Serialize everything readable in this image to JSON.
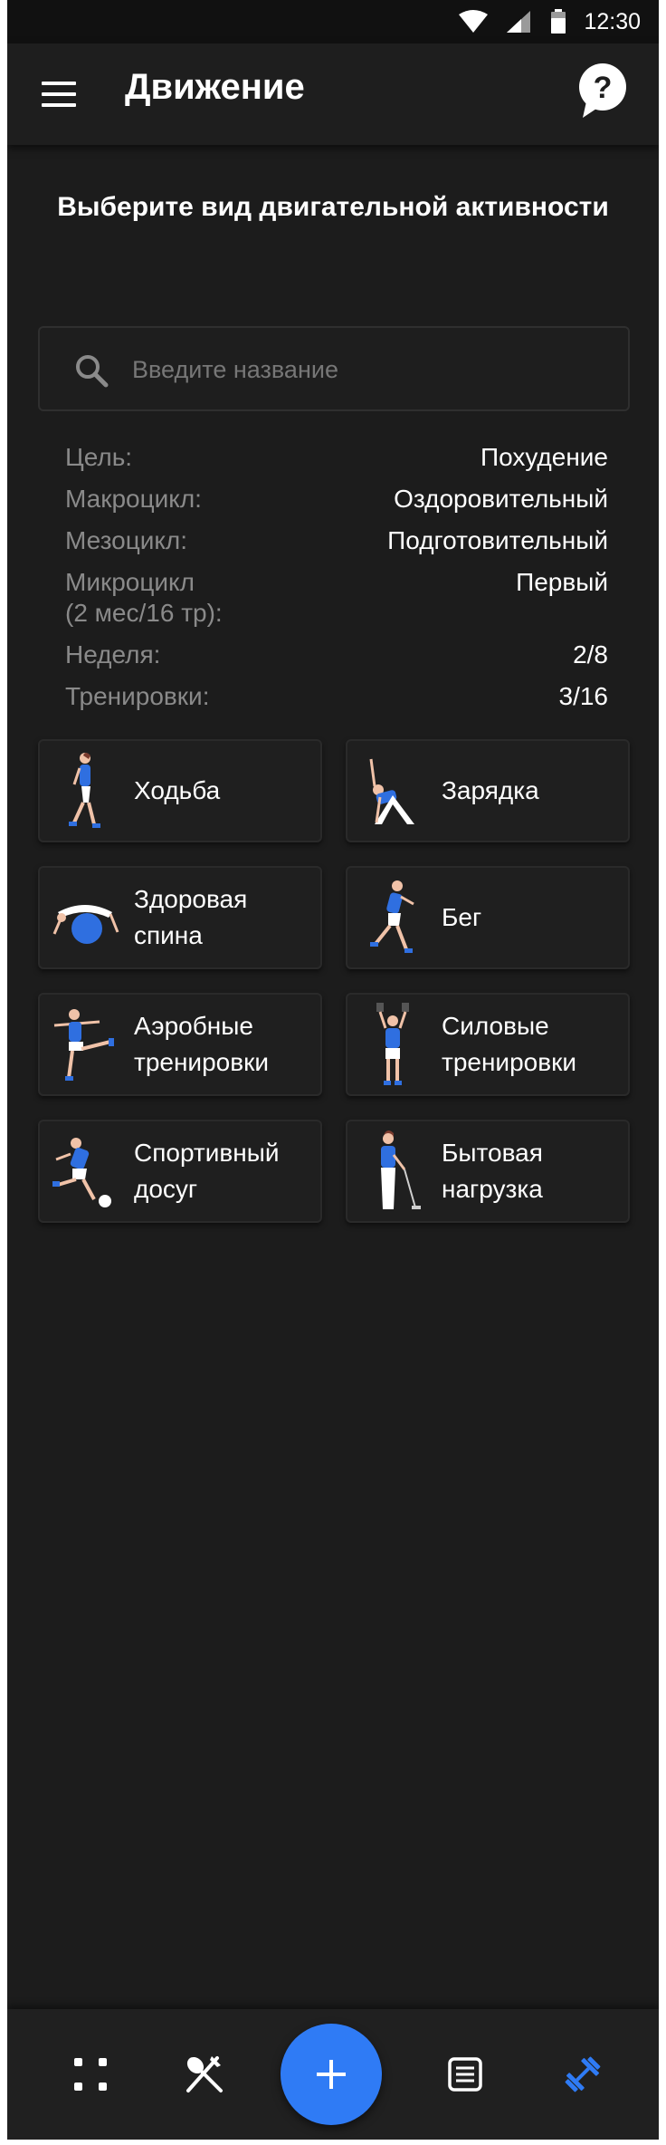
{
  "status_bar": {
    "time": "12:30",
    "icons": [
      "wifi-icon",
      "signal-icon",
      "battery-icon"
    ]
  },
  "app_bar": {
    "title": "Движение",
    "menu_icon": "hamburger-menu-icon",
    "help_icon": "help-question-icon"
  },
  "main": {
    "subtitle": "Выберите вид двигательной активности",
    "search": {
      "placeholder": "Введите название",
      "value": "",
      "icon": "search-icon"
    },
    "info": [
      {
        "label": "Цель:",
        "value": "Похудение"
      },
      {
        "label": "Макроцикл:",
        "value": "Оздоровительный"
      },
      {
        "label": "Мезоцикл:",
        "value": "Подготовительный"
      },
      {
        "label": "Микроцикл\n (2 мес/16 тр):",
        "value": "Первый"
      },
      {
        "label": "Неделя:",
        "value": "2/8"
      },
      {
        "label": "Тренировки:",
        "value": "3/16"
      }
    ],
    "activities": [
      {
        "label": "Ходьба",
        "icon": "walking-figure-icon"
      },
      {
        "label": "Зарядка",
        "icon": "stretching-figure-icon"
      },
      {
        "label": "Здоровая\nспина",
        "icon": "fitball-figure-icon"
      },
      {
        "label": "Бег",
        "icon": "running-figure-icon"
      },
      {
        "label": "Аэробные\nтренировки",
        "icon": "aerobics-figure-icon"
      },
      {
        "label": "Силовые\nтренировки",
        "icon": "dumbbells-figure-icon"
      },
      {
        "label": "Спортивный\nдосуг",
        "icon": "football-figure-icon"
      },
      {
        "label": "Бытовая\nнагрузка",
        "icon": "vacuum-figure-icon"
      }
    ]
  },
  "bottom_nav": {
    "items": [
      "dashboard-dots-icon",
      "food-spoon-fork-icon",
      "add-plus-icon",
      "notes-list-icon",
      "dumbbell-icon"
    ],
    "accent": "#2f7bf5",
    "active": "dumbbell-icon"
  },
  "colors": {
    "background": "#1c1c1c",
    "accent": "#2f7bf5",
    "muted_text": "#8a8a8a"
  }
}
